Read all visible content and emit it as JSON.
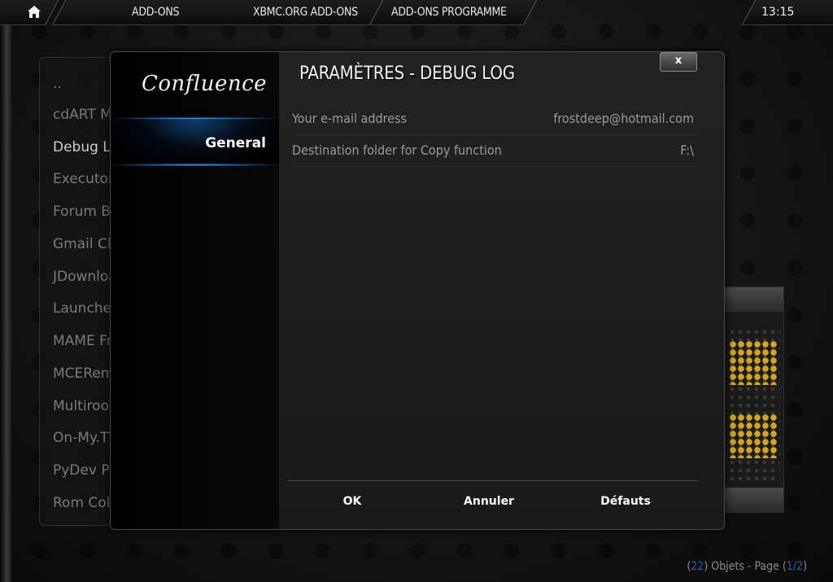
{
  "topbar": {
    "crumbs": [
      "ADD-ONS",
      "XBMC.ORG ADD-ONS",
      "ADD-ONS PROGRAMME"
    ],
    "time": "13:15"
  },
  "background_list": {
    "items": [
      "..",
      "cdART Manager",
      "Debug Log",
      "Executor",
      "Forum Browser",
      "Gmail Checker",
      "JDownloader",
      "Launcher",
      "MAME Frontend",
      "MCERemote",
      "Multiroom",
      "On-My.TV",
      "PyDev Project",
      "Rom Collection"
    ],
    "selected_index": 2
  },
  "footer": {
    "count_open": "(",
    "count": "22",
    "count_close": ")",
    "objects_page_text": " Objets - Page (",
    "page": "1/2",
    "page_close": ")"
  },
  "dialog": {
    "logo_text": "Confluence",
    "title": "PARAMÈTRES - DEBUG LOG",
    "close_label": "x",
    "categories": [
      {
        "label": "General",
        "selected": true
      }
    ],
    "settings": [
      {
        "label": "Your e-mail address",
        "value": "frostdeep@hotmail.com"
      },
      {
        "label": "Destination folder for Copy function",
        "value": "F:\\"
      }
    ],
    "buttons": {
      "ok": "OK",
      "cancel": "Annuler",
      "defaults": "Défauts"
    }
  },
  "colors": {
    "accent_blue": "#2f8fe0",
    "footer_highlight": "#2f5fa6"
  },
  "icons": {
    "home": "home-icon"
  }
}
